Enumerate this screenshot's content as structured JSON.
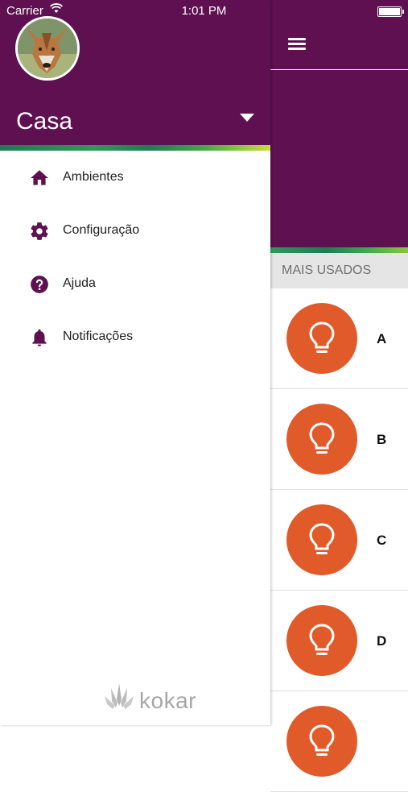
{
  "status_bar": {
    "carrier": "Carrier",
    "time": "1:01 PM"
  },
  "drawer": {
    "account_name": "Casa",
    "menu_items": [
      {
        "label": "Ambientes",
        "icon": "home-icon"
      },
      {
        "label": "Configuração",
        "icon": "gear-icon"
      },
      {
        "label": "Ajuda",
        "icon": "help-icon"
      },
      {
        "label": "Notificações",
        "icon": "bell-icon"
      }
    ],
    "brand": "kokar"
  },
  "main": {
    "section_title": "MAIS USADOS",
    "devices": [
      {
        "label": "A",
        "icon": "lightbulb-icon"
      },
      {
        "label": "B",
        "icon": "lightbulb-icon"
      },
      {
        "label": "C",
        "icon": "lightbulb-icon"
      },
      {
        "label": "D",
        "icon": "lightbulb-icon"
      },
      {
        "label": "",
        "icon": "lightbulb-icon"
      }
    ]
  },
  "colors": {
    "primary": "#5e1050",
    "accent": "#e05a2a",
    "stripe_green": "#1b7d57",
    "stripe_yellow": "#cddc39"
  }
}
